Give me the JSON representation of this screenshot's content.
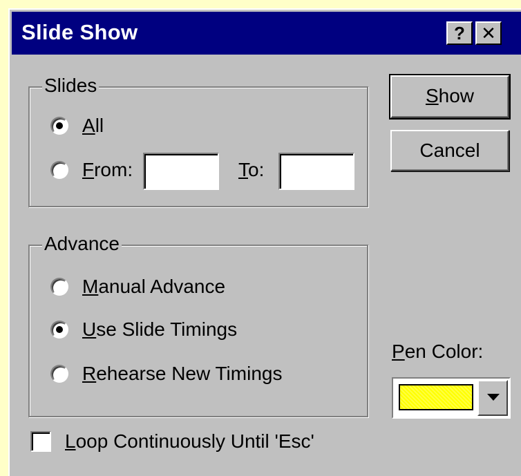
{
  "window": {
    "title": "Slide Show",
    "help_label": "?",
    "close_label": "✕"
  },
  "slides": {
    "group_label": "Slides",
    "all": {
      "key": "A",
      "rest": "ll",
      "selected": true
    },
    "from": {
      "key": "F",
      "rest": "rom:",
      "value": "",
      "selected": false
    },
    "to": {
      "key": "T",
      "rest": "o:",
      "value": ""
    }
  },
  "advance": {
    "group_label": "Advance",
    "manual": {
      "key": "M",
      "rest": "anual Advance",
      "selected": false
    },
    "timings": {
      "key": "U",
      "rest": "se Slide Timings",
      "selected": true
    },
    "rehearse": {
      "key": "R",
      "rest": "ehearse New Timings",
      "selected": false
    }
  },
  "buttons": {
    "show": {
      "key": "S",
      "rest": "how"
    },
    "cancel": "Cancel"
  },
  "pen": {
    "key": "P",
    "rest": "en Color:",
    "color": "#ffff00"
  },
  "loop": {
    "key": "L",
    "rest": "oop Continuously Until 'Esc'",
    "checked": false
  }
}
